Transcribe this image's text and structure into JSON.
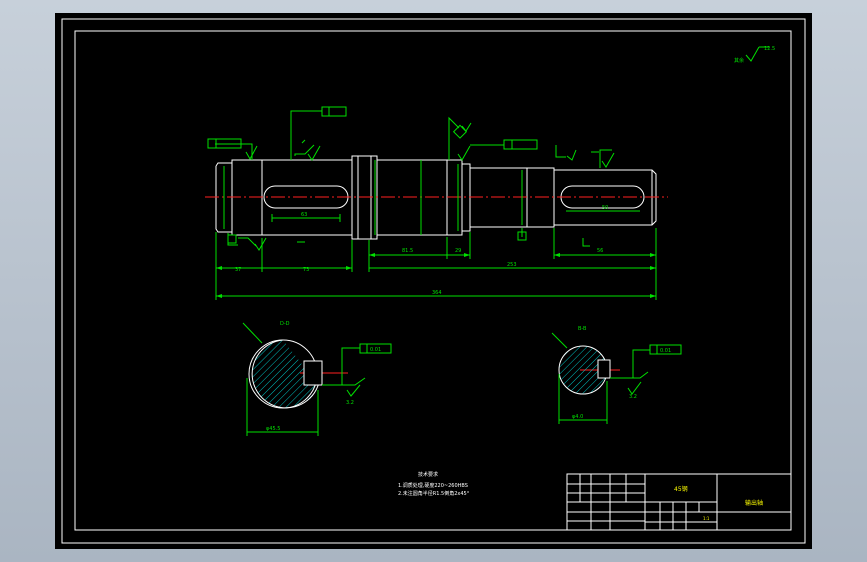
{
  "drawing": {
    "roughness_corner": "其余",
    "roughness_corner_value": "12.5",
    "dims": {
      "d_37": "37",
      "d_73": "73",
      "d_81_5": "81.5",
      "d_29": "29",
      "d_253": "253",
      "d_56": "56",
      "d_364": "364",
      "d_63": "63",
      "d_50": "50"
    },
    "section_left": {
      "label": "D-D",
      "dia": "φ45.5",
      "tol": "0.01",
      "rough": "3.2"
    },
    "section_right": {
      "label": "B-B",
      "dia": "φ4.0",
      "tol": "0.01",
      "rough": "3.2"
    },
    "tech_title": "技术要求",
    "tech_lines": [
      "1.调质处理,硬度220~260HBS",
      "2.未注圆角半径R1.5倒角2x45°"
    ],
    "title_block": {
      "material": "45钢",
      "part_name": "输出轴",
      "scale": "1:1"
    }
  }
}
